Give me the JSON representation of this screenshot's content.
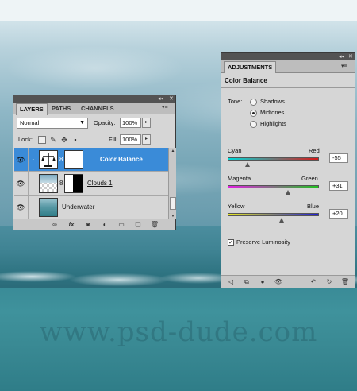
{
  "layers_panel": {
    "tabs": [
      "LAYERS",
      "PATHS",
      "CHANNELS"
    ],
    "active_tab": "LAYERS",
    "blend_mode": "Normal",
    "opacity_label": "Opacity:",
    "opacity_value": "100%",
    "lock_label": "Lock:",
    "fill_label": "Fill:",
    "fill_value": "100%",
    "layers": [
      {
        "name": "Color Balance",
        "selected": true,
        "type": "adjustment"
      },
      {
        "name": "Clouds 1",
        "selected": false,
        "type": "masked"
      },
      {
        "name": "Underwater",
        "selected": false,
        "type": "image"
      }
    ],
    "selection_color": "#3a8bd8"
  },
  "adjustments_panel": {
    "tab": "ADJUSTMENTS",
    "title": "Color Balance",
    "tone_label": "Tone:",
    "tones": [
      "Shadows",
      "Midtones",
      "Highlights"
    ],
    "selected_tone": "Midtones",
    "sliders": [
      {
        "left": "Cyan",
        "right": "Red",
        "value": "-55",
        "position": 0.22
      },
      {
        "left": "Magenta",
        "right": "Green",
        "value": "+31",
        "position": 0.66
      },
      {
        "left": "Yellow",
        "right": "Blue",
        "value": "+20",
        "position": 0.59
      }
    ],
    "preserve_luminosity_label": "Preserve Luminosity",
    "preserve_luminosity": true
  },
  "watermark": "www.psd-dude.com"
}
